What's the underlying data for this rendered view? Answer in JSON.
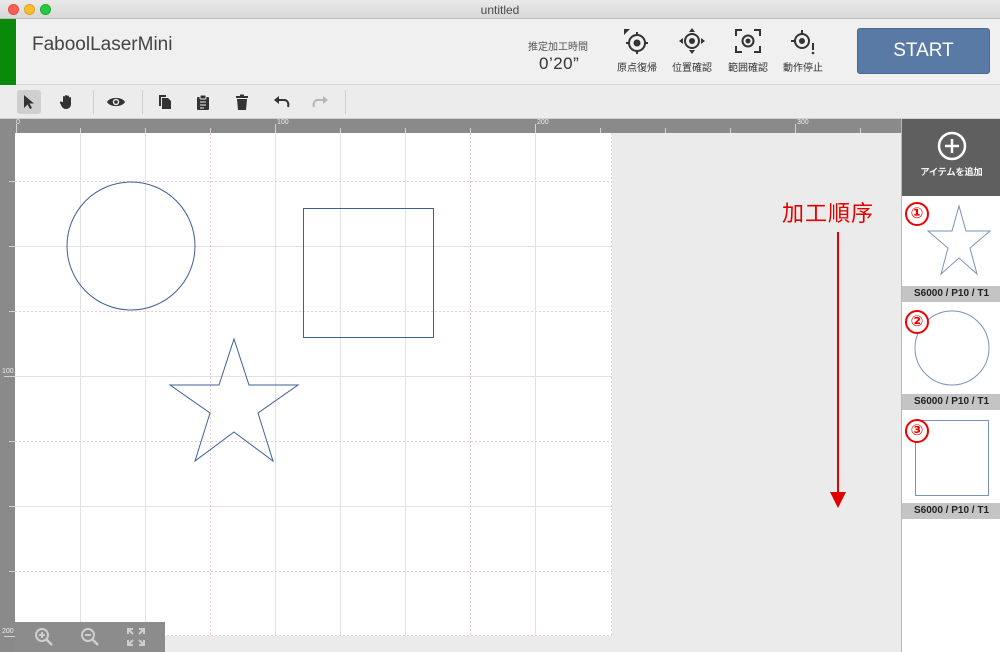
{
  "window": {
    "title": "untitled"
  },
  "header": {
    "app_name": "FaboolLaserMini",
    "time_label": "推定加工時間",
    "time_value": "0’20”",
    "tools": [
      {
        "label": "原点復帰",
        "icon": "home-origin-icon"
      },
      {
        "label": "位置確認",
        "icon": "position-check-icon"
      },
      {
        "label": "範囲確認",
        "icon": "range-check-icon"
      },
      {
        "label": "動作停止",
        "icon": "stop-motion-icon"
      }
    ],
    "start_label": "START"
  },
  "toolbar": {
    "tools": [
      "select-arrow-icon",
      "pan-hand-icon",
      "preview-eye-icon",
      "copy-icon",
      "paste-icon",
      "delete-trash-icon",
      "undo-icon",
      "redo-icon"
    ]
  },
  "rulers": {
    "top_labels": [
      "0",
      "100",
      "200",
      "300"
    ],
    "left_labels": [
      "100",
      "200"
    ]
  },
  "side_panel": {
    "add_label": "アイテムを追加",
    "items": [
      {
        "number": "①",
        "shape": "star",
        "params": "S6000 / P10 / T1"
      },
      {
        "number": "②",
        "shape": "circle",
        "params": "S6000 / P10 / T1"
      },
      {
        "number": "③",
        "shape": "square",
        "params": "S6000 / P10 / T1"
      }
    ]
  },
  "annotation": {
    "order_label": "加工順序"
  },
  "colors": {
    "accent": "#5a7aa6",
    "status_green": "#0a8a0a",
    "annotation_red": "#e00000",
    "shape_stroke": "#3e5f96"
  }
}
